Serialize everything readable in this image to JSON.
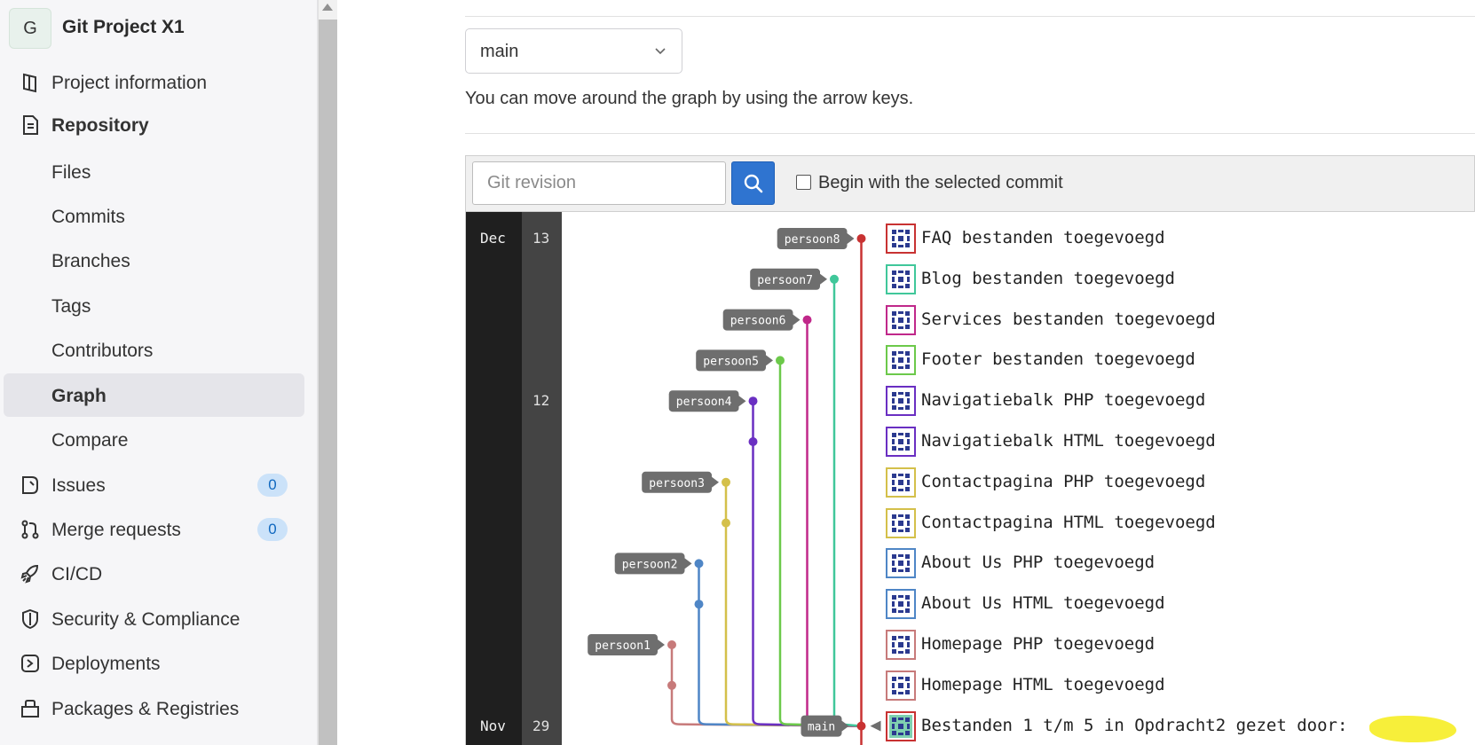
{
  "project": {
    "avatar_letter": "G",
    "name": "Git Project X1"
  },
  "sidebar": {
    "items": [
      {
        "label": "Project information",
        "icon": "project-info-icon"
      },
      {
        "label": "Repository",
        "icon": "repository-icon"
      },
      {
        "label": "Files"
      },
      {
        "label": "Commits"
      },
      {
        "label": "Branches"
      },
      {
        "label": "Tags"
      },
      {
        "label": "Contributors"
      },
      {
        "label": "Graph",
        "active": true
      },
      {
        "label": "Compare"
      },
      {
        "label": "Issues",
        "icon": "issues-icon",
        "badge": "0"
      },
      {
        "label": "Merge requests",
        "icon": "merge-request-icon",
        "badge": "0"
      },
      {
        "label": "CI/CD",
        "icon": "rocket-icon"
      },
      {
        "label": "Security & Compliance",
        "icon": "shield-icon"
      },
      {
        "label": "Deployments",
        "icon": "deployments-icon"
      },
      {
        "label": "Packages & Registries",
        "icon": "package-icon"
      }
    ]
  },
  "branch_selector": {
    "value": "main"
  },
  "hint": "You can move around the graph by using the arrow keys.",
  "toolbar": {
    "revision_placeholder": "Git revision",
    "begin_label": "Begin with the selected commit"
  },
  "graph": {
    "months": [
      {
        "label": "Dec",
        "row": 0
      },
      {
        "label": "Nov",
        "row": 12
      }
    ],
    "days": [
      {
        "label": "13",
        "row": 0
      },
      {
        "label": "12",
        "row": 4
      },
      {
        "label": "29",
        "row": 12
      }
    ],
    "commits": [
      {
        "message": "FAQ bestanden toegevoegd",
        "branch": "persoon8",
        "lane": 7
      },
      {
        "message": "Blog bestanden toegevoegd",
        "branch": "persoon7",
        "lane": 6
      },
      {
        "message": "Services bestanden toegevoegd",
        "branch": "persoon6",
        "lane": 5
      },
      {
        "message": "Footer bestanden toegevoegd",
        "branch": "persoon5",
        "lane": 4
      },
      {
        "message": "Navigatiebalk PHP toegevoegd",
        "branch": "persoon4",
        "lane": 3
      },
      {
        "message": "Navigatiebalk HTML toegevoegd",
        "branch": "",
        "lane": 3
      },
      {
        "message": "Contactpagina PHP toegevoegd",
        "branch": "persoon3",
        "lane": 2
      },
      {
        "message": "Contactpagina HTML toegevoegd",
        "branch": "",
        "lane": 2
      },
      {
        "message": "About Us PHP toegevoegd",
        "branch": "persoon2",
        "lane": 1
      },
      {
        "message": "About Us HTML toegevoegd",
        "branch": "",
        "lane": 1
      },
      {
        "message": "Homepage PHP toegevoegd",
        "branch": "persoon1",
        "lane": 0
      },
      {
        "message": "Homepage HTML toegevoegd",
        "branch": "",
        "lane": 0
      },
      {
        "message": "Bestanden 1 t/m 5 in Opdracht2 gezet door:",
        "branch": "main",
        "lane": 7
      }
    ],
    "lane_colors": [
      "#c77a7a",
      "#4f86c6",
      "#d4c04a",
      "#6a2fc2",
      "#6cc94a",
      "#c0288a",
      "#40c79a",
      "#c83232"
    ]
  }
}
